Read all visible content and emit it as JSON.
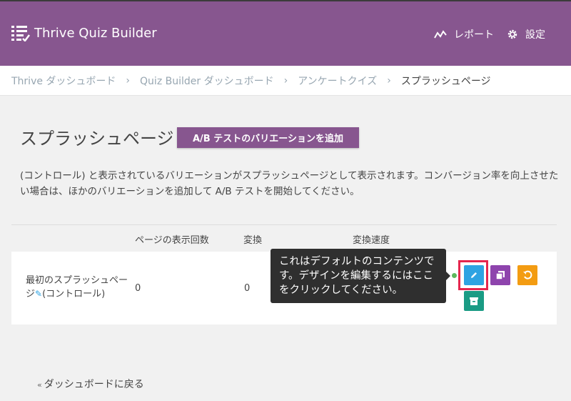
{
  "header": {
    "app_title": "Thrive Quiz Builder",
    "nav": {
      "reports_label": "レポート",
      "settings_label": "設定"
    }
  },
  "breadcrumb": {
    "items": [
      "Thrive ダッシュボード",
      "Quiz Builder ダッシュボード",
      "アンケートクイズ",
      "スプラッシュページ"
    ],
    "separator": "›"
  },
  "main": {
    "page_title": "スプラッシュページ",
    "ab_button_label": "A/B テストのバリエーションを追加",
    "description": "(コントロール) と表示されているバリエーションがスプラッシュページとして表示されます。コンバージョン率を向上させたい場合は、ほかのバリエーションを追加して A/B テストを開始してください。"
  },
  "table": {
    "headers": {
      "views": "ページの表示回数",
      "conversions": "変換",
      "conversion_rate": "変換速度"
    },
    "rows": [
      {
        "name": "最初のスプラッシュページ",
        "control_label": "(コントロール)",
        "views": "0",
        "conversions": "0"
      }
    ]
  },
  "tooltip": {
    "text": "これはデフォルトのコンテンツです。デザインを編集するにはここをクリックしてください。"
  },
  "footer": {
    "back_marker": "«",
    "back_label": "ダッシュボードに戻る"
  },
  "colors": {
    "brand_purple": "#87568f",
    "edit_blue": "#2ea3e2",
    "copy_purple": "#8e44ad",
    "reset_orange": "#f39c12",
    "archive_teal": "#1a9b84",
    "highlight_red": "#e5264e",
    "status_green": "#5cb85c"
  },
  "icons": [
    "list-check-icon",
    "chart-line-icon",
    "gear-icon",
    "pencil-icon",
    "copy-icon",
    "reset-icon",
    "archive-icon"
  ]
}
